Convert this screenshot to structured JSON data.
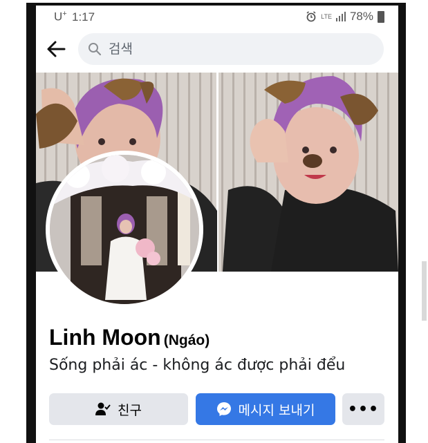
{
  "status_bar": {
    "carrier": "U",
    "carrier_sup": "+",
    "time": "1:17",
    "network": "LTE",
    "battery": "78%"
  },
  "header": {
    "back_icon": "arrow-left-icon",
    "search_icon": "search-icon",
    "search_placeholder": "검색"
  },
  "profile": {
    "name": "Linh Moon",
    "nickname": "(Ngáo)",
    "bio": "Sống phải ác - không ác được phải đểu"
  },
  "actions": {
    "friend_label": "친구",
    "friend_icon": "friend-check-icon",
    "message_label": "메시지 보내기",
    "message_icon": "messenger-icon",
    "more_label": "•••"
  },
  "colors": {
    "message_button": "#3578e5",
    "secondary_button": "#e4e6eb"
  }
}
